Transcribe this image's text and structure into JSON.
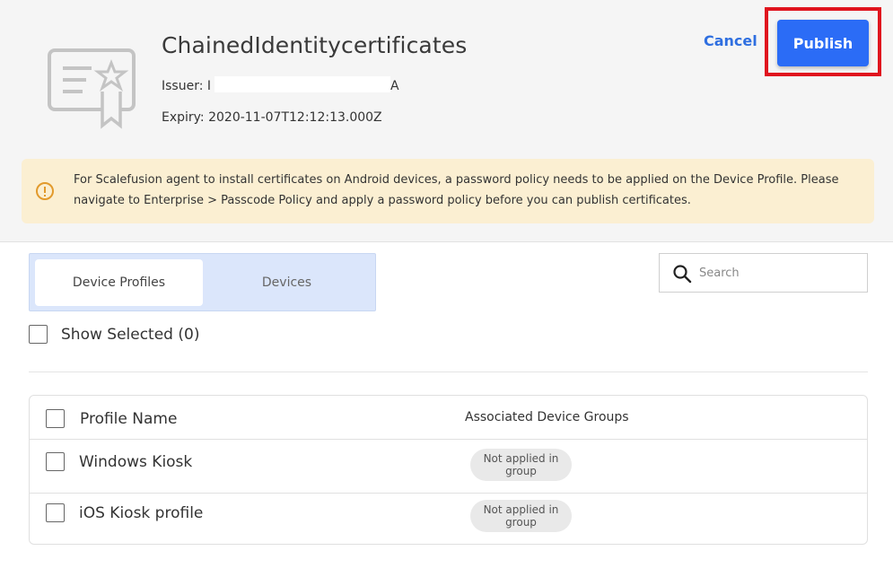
{
  "certificate": {
    "title": "ChainedIdentitycertificates",
    "issuer_label": "Issuer:",
    "issuer_value_start": "I",
    "issuer_value_end": "A",
    "expiry": "Expiry: 2020-11-07T12:12:13.000Z"
  },
  "actions": {
    "cancel_label": "Cancel",
    "publish_label": "Publish"
  },
  "alert": {
    "icon": "info-icon",
    "text": "For Scalefusion agent to install certificates on Android devices, a password policy needs to be applied on the Device Profile. Please navigate to Enterprise > Passcode Policy and apply a password policy before you can publish certificates."
  },
  "tabs": [
    {
      "label": "Device Profiles",
      "active": true
    },
    {
      "label": "Devices",
      "active": false
    }
  ],
  "search": {
    "placeholder": "Search",
    "value": ""
  },
  "show_selected": {
    "label": "Show Selected (0)"
  },
  "table": {
    "headers": {
      "name": "Profile Name",
      "groups": "Associated Device Groups"
    },
    "rows": [
      {
        "name": "Windows Kiosk",
        "group_badge_line1": "Not applied in",
        "group_badge_line2": "group"
      },
      {
        "name": "iOS Kiosk profile",
        "group_badge_line1": "Not applied in",
        "group_badge_line2": "group"
      }
    ]
  },
  "colors": {
    "accent": "#2b6cf6",
    "link": "#2f6fe0",
    "highlight": "#e0141e",
    "alert_bg": "#fbefd2",
    "alert_icon": "#e29a2c"
  }
}
